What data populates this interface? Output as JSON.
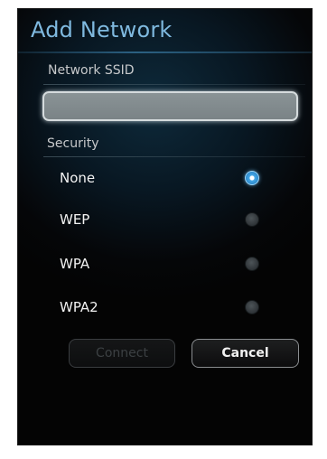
{
  "dialog": {
    "title": "Add Network",
    "ssid": {
      "label": "Network SSID",
      "value": "",
      "placeholder": ""
    },
    "security": {
      "label": "Security",
      "options": [
        {
          "label": "None",
          "selected": true
        },
        {
          "label": "WEP",
          "selected": false
        },
        {
          "label": "WPA",
          "selected": false
        },
        {
          "label": "WPA2",
          "selected": false
        }
      ]
    },
    "buttons": {
      "connect_label": "Connect",
      "connect_enabled": false,
      "cancel_label": "Cancel"
    }
  },
  "colors": {
    "title": "#7fb9df",
    "accent_radio": "#46a8e6",
    "background": "#050608"
  }
}
